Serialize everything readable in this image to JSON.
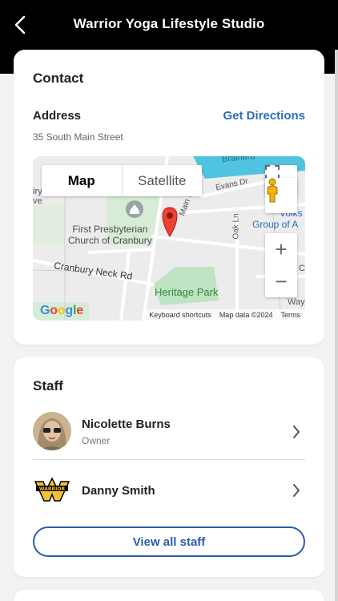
{
  "header": {
    "title": "Warrior Yoga Lifestyle Studio",
    "back_icon": "chevron-left-icon"
  },
  "contact": {
    "title": "Contact",
    "address_label": "Address",
    "directions_label": "Get Directions",
    "address_value": "35 South Main Street"
  },
  "map": {
    "map_label": "Map",
    "satellite_label": "Satellite",
    "places": {
      "church": "First Presbyterian\nChurch of Cranbury",
      "park": "Heritage Park",
      "neck_rd": "Cranbury Neck Rd",
      "evans": "Evans Dr",
      "oak": "Oak Ln",
      "main": "Main S",
      "volks": "Volks",
      "group": "Group of A",
      "brainerd": "Brainerd",
      "iry": "iry",
      "ve": "ve",
      "way": "Way",
      "c": "C"
    },
    "footer": {
      "shortcuts": "Keyboard shortcuts",
      "data": "Map data ©2024",
      "terms": "Terms"
    },
    "zoom_in": "+",
    "zoom_out": "−"
  },
  "staff": {
    "title": "Staff",
    "members": [
      {
        "name": "Nicolette Burns",
        "role": "Owner"
      },
      {
        "name": "Danny Smith",
        "role": ""
      }
    ],
    "view_all_label": "View all staff"
  },
  "colors": {
    "accent": "#2a6ebd",
    "button_border": "#2a5db0",
    "header_bg": "#000000"
  }
}
